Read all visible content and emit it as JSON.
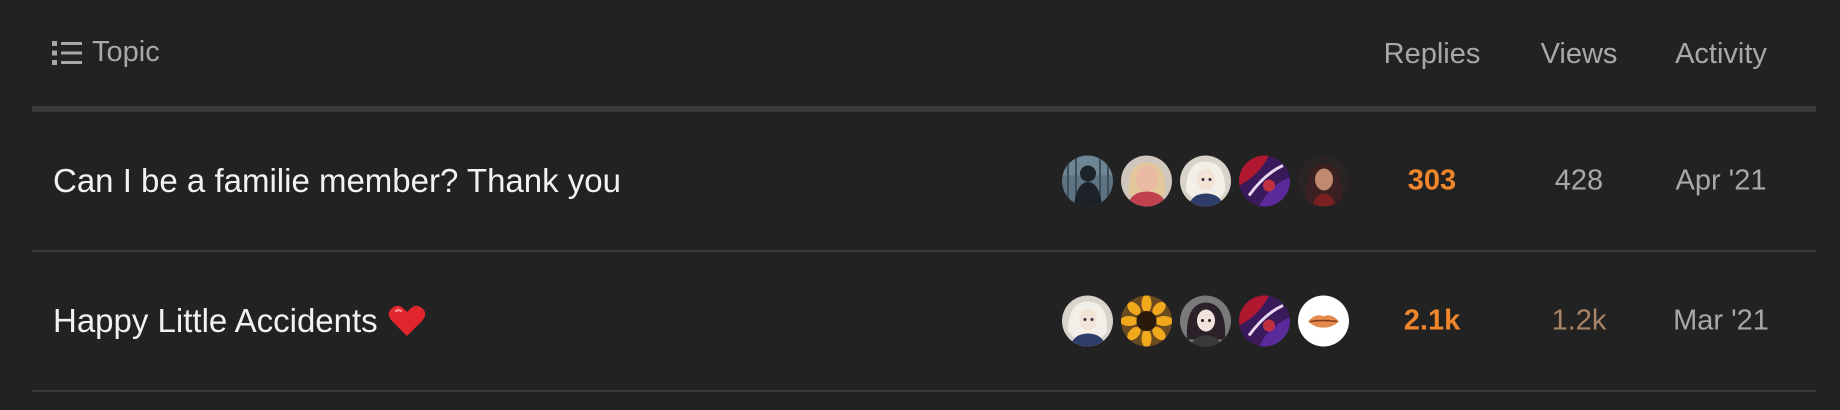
{
  "header": {
    "topic_label": "Topic",
    "replies_label": "Replies",
    "views_label": "Views",
    "activity_label": "Activity",
    "topic_icon": "list-icon"
  },
  "topics": [
    {
      "title": "Can I be a familie member? Thank you",
      "title_emoji": "",
      "replies": "303",
      "views": "428",
      "activity": "Apr '21",
      "replies_color": "#f0852c",
      "views_color": "#a8a8a8",
      "poster_avatars": [
        "dark-figure-avatar",
        "blonde-woman-avatar",
        "anime-white-hair-avatar",
        "red-purple-art-avatar",
        "dark-haired-woman-avatar"
      ]
    },
    {
      "title": "Happy Little Accidents",
      "title_emoji": "heart-icon",
      "replies": "2.1k",
      "views": "1.2k",
      "activity": "Mar '21",
      "replies_color": "#f0852c",
      "views_color": "#a88466",
      "poster_avatars": [
        "anime-white-hair-avatar",
        "sunflower-avatar",
        "anime-dark-hair-avatar",
        "red-purple-art-avatar",
        "lips-avatar"
      ]
    }
  ]
}
